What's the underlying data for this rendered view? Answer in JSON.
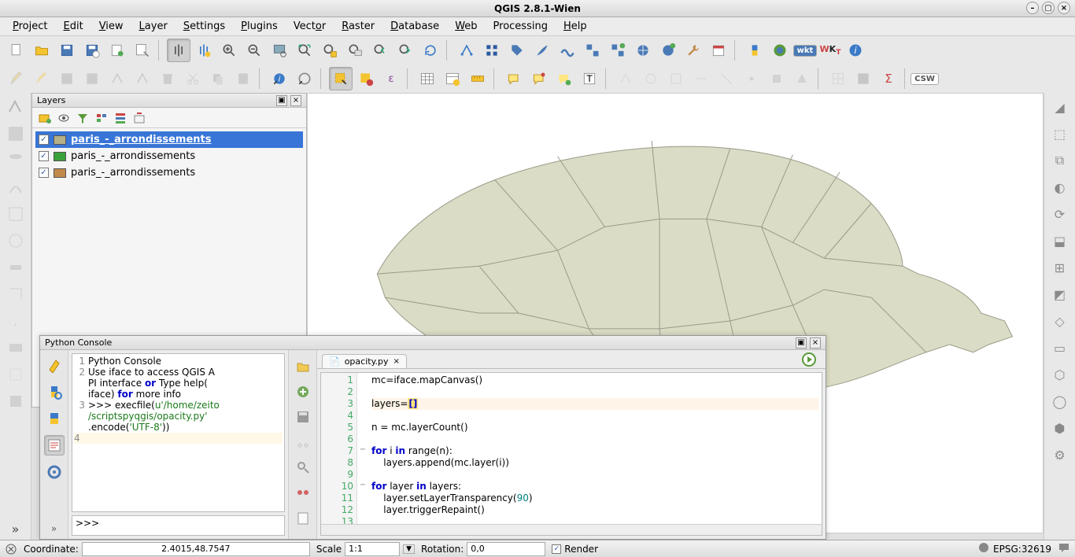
{
  "window": {
    "title": "QGIS 2.8.1-Wien"
  },
  "menubar": [
    "Project",
    "Edit",
    "View",
    "Layer",
    "Settings",
    "Plugins",
    "Vector",
    "Raster",
    "Database",
    "Web",
    "Processing",
    "Help"
  ],
  "toolbar_row1_badges": [
    "wkt",
    "WKT",
    "CSW"
  ],
  "layers_panel": {
    "title": "Layers",
    "items": [
      {
        "name": "paris_-_arrondissements",
        "checked": true,
        "selected": true,
        "swatch": "#b5b088"
      },
      {
        "name": "paris_-_arrondissements",
        "checked": true,
        "selected": false,
        "swatch": "#3aa23a"
      },
      {
        "name": "paris_-_arrondissements",
        "checked": true,
        "selected": false,
        "swatch": "#c18a4a"
      }
    ]
  },
  "python_console": {
    "title": "Python Console",
    "prompt": ">>>",
    "output_lines": [
      {
        "n": 1,
        "text": "Python Console"
      },
      {
        "n": 2,
        "text": "Use iface to access QGIS API interface or Type help(iface) for more info",
        "kw_or": true
      },
      {
        "n": 3,
        "text": ">>> execfile(u'/home/zeito/scriptspyqgis/opacity.py'.encode('UTF-8'))"
      },
      {
        "n": 4,
        "text": "",
        "hl": true
      }
    ],
    "editor": {
      "tab": "opacity.py",
      "lines": [
        "mc=iface.mapCanvas()",
        "",
        "layers=[]",
        "",
        "n = mc.layerCount()",
        "",
        "for i in range(n):",
        "    layers.append(mc.layer(i))",
        "",
        "for layer in layers:",
        "    layer.setLayerTransparency(90)",
        "    layer.triggerRepaint()",
        ""
      ],
      "current_line": 3
    }
  },
  "statusbar": {
    "coordinate_label": "Coordinate:",
    "coordinate_value": "2.4015,48.7547",
    "scale_label": "Scale",
    "scale_value": "1:1",
    "rotation_label": "Rotation:",
    "rotation_value": "0,0",
    "render_checked": true,
    "render_label": "Render",
    "crs": "EPSG:32619"
  }
}
